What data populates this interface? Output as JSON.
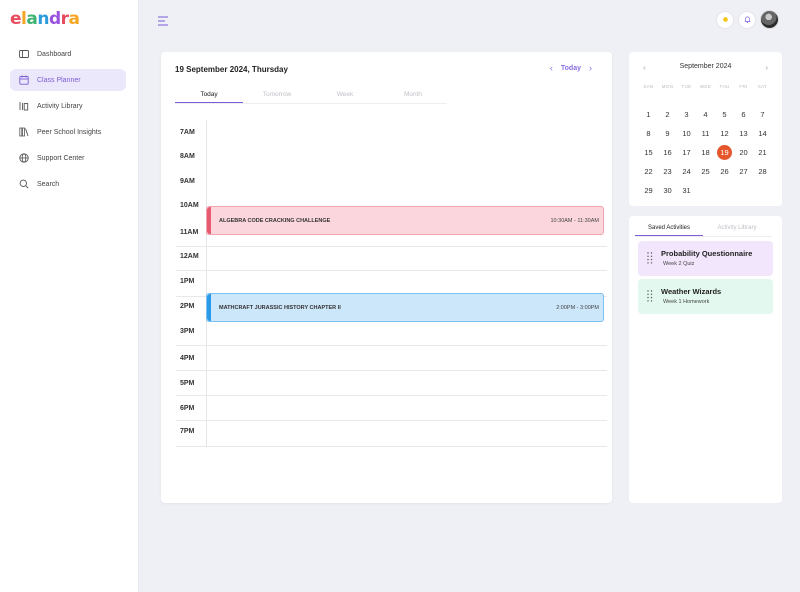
{
  "app": {
    "logo_letters": [
      "e",
      "l",
      "a",
      "n",
      "d",
      "r",
      "a"
    ],
    "logo_colors": [
      "#e84a5f",
      "#f6a623",
      "#3cb371",
      "#2d9cdb",
      "#9b51e0",
      "#e84a5f",
      "#f6a623"
    ]
  },
  "sidebar": {
    "items": [
      {
        "label": "Dashboard",
        "icon": "layout-icon",
        "active": false
      },
      {
        "label": "Class Planner",
        "icon": "calendar-icon",
        "active": true
      },
      {
        "label": "Activity Library",
        "icon": "library-icon",
        "active": false
      },
      {
        "label": "Peer School Insights",
        "icon": "books-icon",
        "active": false
      },
      {
        "label": "Support Center",
        "icon": "globe-icon",
        "active": false
      },
      {
        "label": "Search",
        "icon": "search-icon",
        "active": false
      }
    ]
  },
  "planner": {
    "date_title": "19 September 2024, Thursday",
    "today_label": "Today",
    "tabs": [
      "Today",
      "Tomorrow",
      "Week",
      "Month"
    ],
    "times": [
      "7AM",
      "8AM",
      "9AM",
      "10AM",
      "11AM",
      "12AM",
      "1PM",
      "2PM",
      "3PM",
      "4PM",
      "5PM",
      "6PM",
      "7PM"
    ],
    "events": [
      {
        "title": "ALGEBRA CODE CRACKING CHALLENGE",
        "time": "10:30AM - 11:30AM",
        "color": "red"
      },
      {
        "title": "MATHCRAFT JURASSIC HISTORY CHAPTER II",
        "time": "2:00PM - 3:00PM",
        "color": "blue"
      }
    ]
  },
  "mini_calendar": {
    "month_label": "September 2024",
    "weekdays": [
      "SAN",
      "MON",
      "TUE",
      "WED",
      "THU",
      "FRI",
      "SAT"
    ],
    "days": [
      "1",
      "2",
      "3",
      "4",
      "5",
      "6",
      "7",
      "8",
      "9",
      "10",
      "11",
      "12",
      "13",
      "14",
      "15",
      "16",
      "17",
      "18",
      "19",
      "20",
      "21",
      "22",
      "23",
      "24",
      "25",
      "26",
      "27",
      "28",
      "29",
      "30",
      "31"
    ],
    "selected": "19",
    "selected_color": "#e5562d"
  },
  "activities": {
    "tabs": [
      "Saved Activities",
      "Activity Library"
    ],
    "items": [
      {
        "title": "Probability Questionnaire",
        "subtitle": "Week 2 Quiz",
        "color": "purple"
      },
      {
        "title": "Weather Wizards",
        "subtitle": "Week 1 Homework",
        "color": "mint"
      }
    ]
  },
  "colors": {
    "accent": "#7b5cd6",
    "event_red": "#e7596e",
    "event_blue": "#2b9ae9"
  }
}
